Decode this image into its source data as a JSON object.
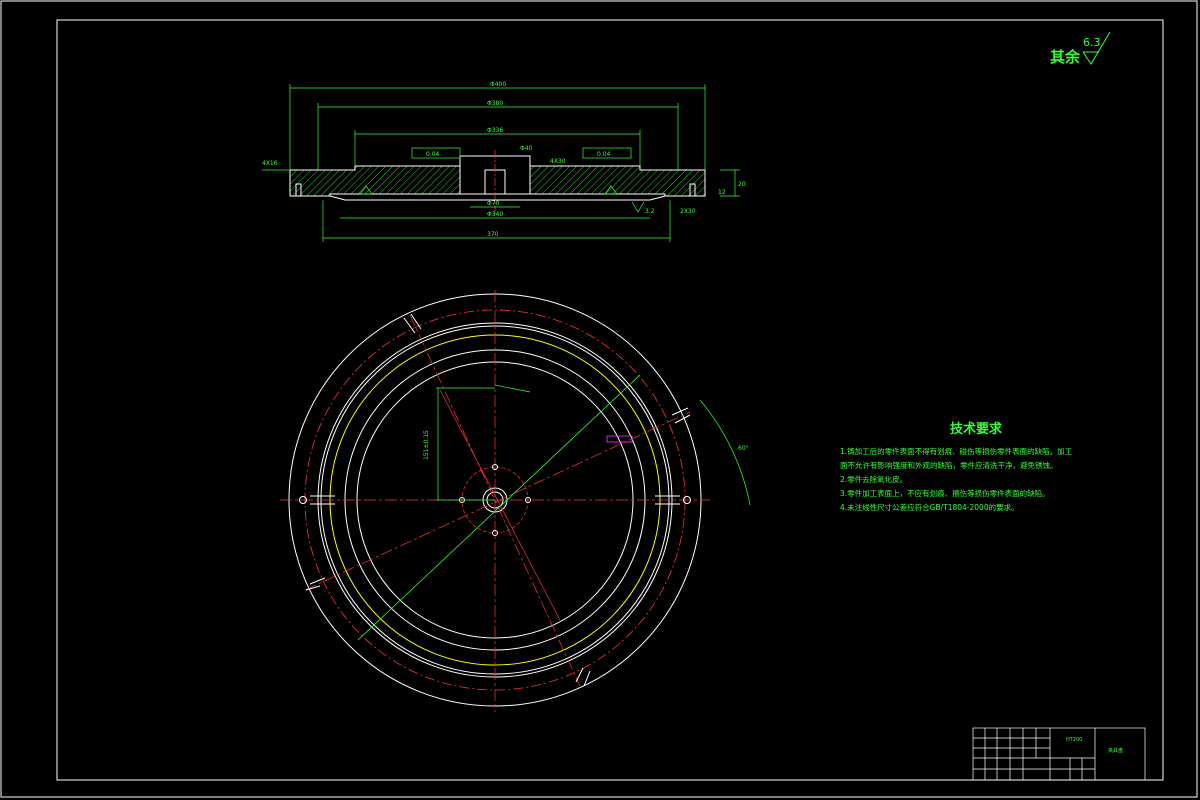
{
  "roughness": {
    "label": "其余",
    "value": "6.3"
  },
  "tech_requirements": {
    "title": "技术要求",
    "lines": [
      "1.铸加工后的零件表面不得有划痕、碰伤等损伤零件表面的缺陷。加工",
      "面不允许有影响强度和外观的缺陷，零件应清洗干净，避免锈蚀。",
      "2.零件去除氧化皮。",
      "3.零件加工表面上，不应有划痕、擦伤等损伤零件表面的缺陷。",
      "4.未注线性尺寸公差应符合GB/T1804-2000的要求。"
    ]
  },
  "title_block": {
    "part_name": "夹具盘",
    "material": "HT200"
  },
  "dimensions": {
    "d1": "Φ400",
    "d2": "Φ380",
    "d3": "Φ336",
    "d4": "Φ40",
    "d5": "Φ70",
    "d6": "Φ340",
    "d7": "370",
    "pos1": "0.04",
    "pos2": "0.04",
    "r1": "3.2",
    "h1": "20",
    "h2": "12",
    "h3": "4X16",
    "d8": "2X30",
    "d9": "4X30",
    "v1": "151±0.15",
    "ang": "60°"
  },
  "colors": {
    "background": "#000000",
    "outline": "#ffffff",
    "dimension": "#33ff33",
    "hatch": "#33ff33",
    "center_line": "#ff3333",
    "pitch_circle": "#ffff00",
    "marker": "#ff33ff"
  }
}
